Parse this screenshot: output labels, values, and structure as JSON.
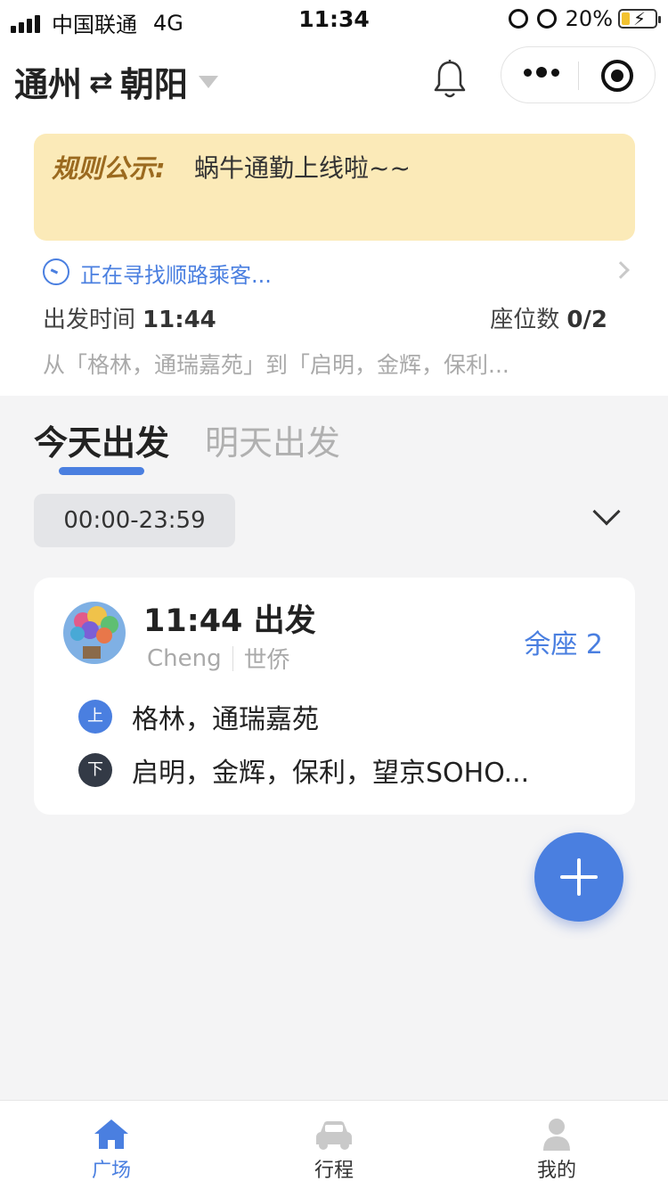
{
  "status_bar": {
    "carrier": "中国联通",
    "network": "4G",
    "time": "11:34",
    "battery": "20%"
  },
  "header": {
    "from": "通州",
    "swap_symbol": "⇄",
    "to": "朝阳"
  },
  "notice": {
    "label": "规则公示:",
    "text": "蜗牛通勤上线啦~~"
  },
  "current_trip": {
    "status": "正在寻找顺路乘客...",
    "departure_label": "出发时间",
    "departure_time": "11:44",
    "seats_label": "座位数",
    "seats_value": "0/2",
    "route_summary": "从「格林，通瑞嘉苑」到「启明，金辉，保利..."
  },
  "tabs": [
    {
      "label": "今天出发",
      "active": true
    },
    {
      "label": "明天出发",
      "active": false
    }
  ],
  "filter": {
    "time_range": "00:00-23:59"
  },
  "trip_card": {
    "time": "11:44 出发",
    "driver_name": "Cheng",
    "driver_company": "世侨",
    "seats_left": "余座 2",
    "pickup_badge": "上",
    "pickup": "格林，通瑞嘉苑",
    "dropoff_badge": "下",
    "dropoff": "启明，金辉，保利，望京SOHO..."
  },
  "tabbar": {
    "items": [
      {
        "label": "广场",
        "icon": "home-icon",
        "active": true
      },
      {
        "label": "行程",
        "icon": "car-icon",
        "active": false
      },
      {
        "label": "我的",
        "icon": "user-icon",
        "active": false
      }
    ]
  },
  "colors": {
    "accent": "#4a7fe0",
    "notice_bg": "#fbeab8",
    "notice_label": "#9b6a1f"
  }
}
